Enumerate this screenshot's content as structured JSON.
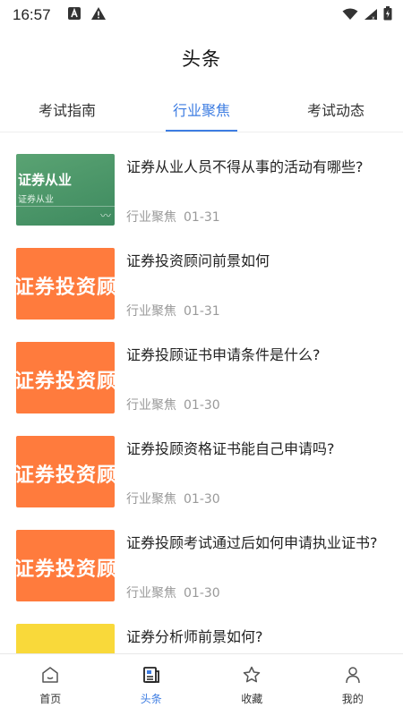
{
  "status": {
    "time": "16:57"
  },
  "header": {
    "title": "头条"
  },
  "tabs": [
    {
      "label": "考试指南",
      "active": false
    },
    {
      "label": "行业聚焦",
      "active": true
    },
    {
      "label": "考试动态",
      "active": false
    }
  ],
  "articles": [
    {
      "title": "证券从业人员不得从事的活动有哪些?",
      "category": "行业聚焦",
      "date": "01-31",
      "thumb_text": "证券从业",
      "thumb_sub": "证券从业",
      "thumb_color": "#4f9a6c"
    },
    {
      "title": "证券投资顾问前景如何",
      "category": "行业聚焦",
      "date": "01-31",
      "thumb_text": "证券投资顾问",
      "thumb_color": "#ff7b3d"
    },
    {
      "title": "证券投顾证书申请条件是什么?",
      "category": "行业聚焦",
      "date": "01-30",
      "thumb_text": "证券投资顾问",
      "thumb_color": "#ff7b3d"
    },
    {
      "title": "证券投顾资格证书能自己申请吗?",
      "category": "行业聚焦",
      "date": "01-30",
      "thumb_text": "证券投资顾问",
      "thumb_color": "#ff7b3d"
    },
    {
      "title": "证券投顾考试通过后如何申请执业证书?",
      "category": "行业聚焦",
      "date": "01-30",
      "thumb_text": "证券投资顾问",
      "thumb_color": "#ff7b3d"
    },
    {
      "title": "证券分析师前景如何?",
      "thumb_color": "#f9d93a"
    }
  ],
  "bottom_nav": [
    {
      "label": "首页",
      "icon": "home-icon",
      "active": false
    },
    {
      "label": "头条",
      "icon": "news-icon",
      "active": true
    },
    {
      "label": "收藏",
      "icon": "star-icon",
      "active": false
    },
    {
      "label": "我的",
      "icon": "person-icon",
      "active": false
    }
  ],
  "colors": {
    "accent": "#3e7de2",
    "meta": "#999999",
    "orange": "#ff7b3d",
    "green": "#4f9a6c",
    "yellow": "#f9d93a"
  }
}
